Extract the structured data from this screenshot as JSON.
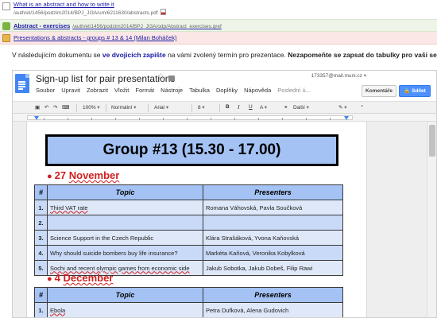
{
  "resources": [
    {
      "title": "What is an abstract and how to write it",
      "path": "/auth/el/1456/podzim2014/BPJ_JI3A/um/6211630/abstracts.pdf",
      "icon": "pdf-icon"
    },
    {
      "title": "Abstract - exercises",
      "path": "/auth/el/1456/podzim2014/BPJ_JI3A/odp/Abstract_exercises.qref",
      "icon": "exercise-icon"
    },
    {
      "title": "Presentations & abstracts - groups # 13 & 14 (Milan Boháček)",
      "icon": "folder-icon"
    }
  ],
  "instruction": {
    "part1": "V následujícím dokumentu se ",
    "highlight": "ve dvojicích zapište",
    "part2": " na vámi zvolený termín pro prezentace. ",
    "bold": "Nezapomeňte se zapsat do tabulky pro vaši seminární s"
  },
  "docs": {
    "title": "Sign-up list for pair presentations",
    "menu": [
      "Soubor",
      "Upravit",
      "Zobrazit",
      "Vložit",
      "Formát",
      "Nástroje",
      "Tabulka",
      "Doplňky",
      "Nápověda"
    ],
    "last_edit": "Poslední ú...",
    "user_email": "173357@mail.muni.cz",
    "comments_label": "Komentáře",
    "share_label": "Sdílet",
    "toolbar": {
      "zoom": "100%",
      "style": "Normální",
      "font": "Arial",
      "size": "8",
      "bold": "B",
      "italic": "I",
      "underline": "U",
      "color": "A",
      "more": "Další"
    }
  },
  "document": {
    "group_heading": "Group #13 (15.30 - 17.00)",
    "sessions": [
      {
        "date_prefix": "27 ",
        "date_month": "November",
        "headers": [
          "#",
          "Topic",
          "Presenters"
        ],
        "rows": [
          {
            "num": "1.",
            "topic": "Third VAT rate",
            "presenters": "Romana Váhovská, Pavla Součková"
          },
          {
            "num": "2.",
            "topic": "",
            "presenters": ""
          },
          {
            "num": "3.",
            "topic": "Science Support in the Czech Republic",
            "presenters": "Klára Strašáková, Yvona Kaňovská"
          },
          {
            "num": "4.",
            "topic": "Why should suicide bombers buy life insurance?",
            "presenters": "Markéta Kaňová, Veronika Kobylková"
          },
          {
            "num": "5.",
            "topic": "Sochi and recent olympic games from economic side",
            "presenters": "Jakub Sobotka, Jakub Dobeš, Filip Rawi"
          }
        ]
      },
      {
        "date_prefix": "4 ",
        "date_month": "December",
        "headers": [
          "#",
          "Topic",
          "Presenters"
        ],
        "rows": [
          {
            "num": "1.",
            "topic": "Ebola",
            "presenters": "Petra Dufková, Alena Gudovich"
          }
        ]
      }
    ]
  }
}
